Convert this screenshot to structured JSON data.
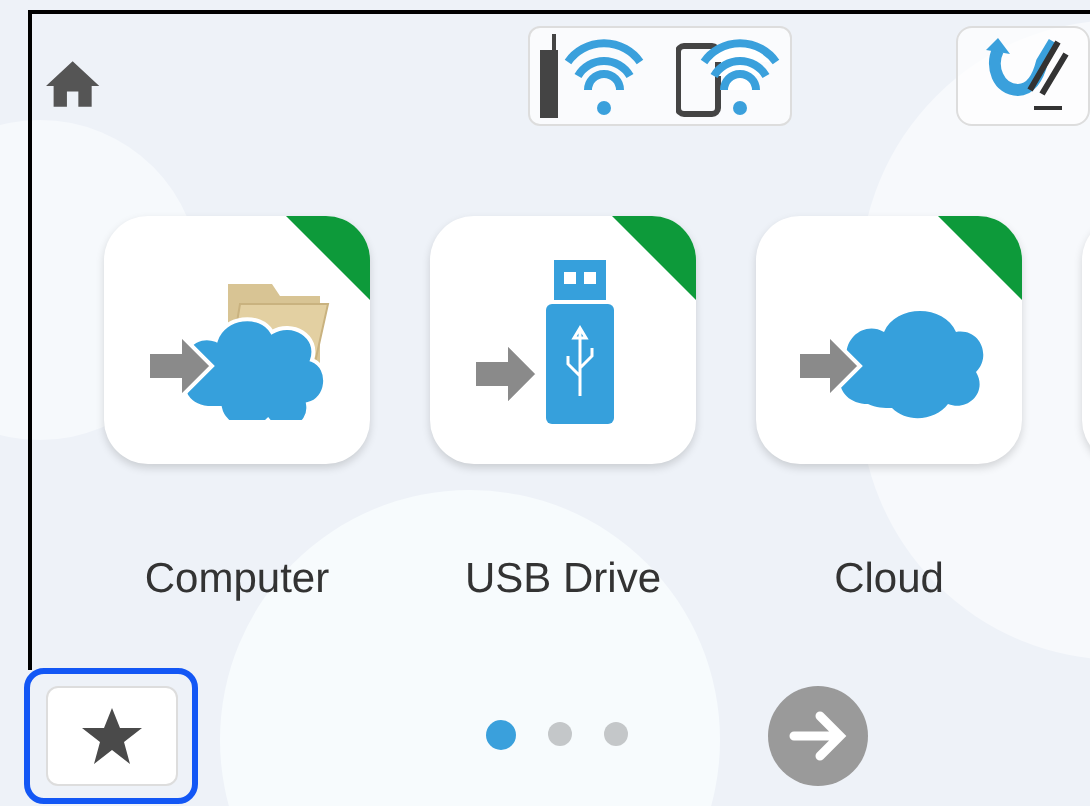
{
  "tiles": [
    {
      "kind": "computer",
      "label": "Computer"
    },
    {
      "kind": "usb",
      "label": "USB Drive"
    },
    {
      "kind": "cloud",
      "label": "Cloud"
    }
  ],
  "favorites_button": {
    "focused": true
  },
  "page_dots": [
    {
      "selected": true
    },
    {
      "selected": false
    },
    {
      "selected": false
    }
  ]
}
